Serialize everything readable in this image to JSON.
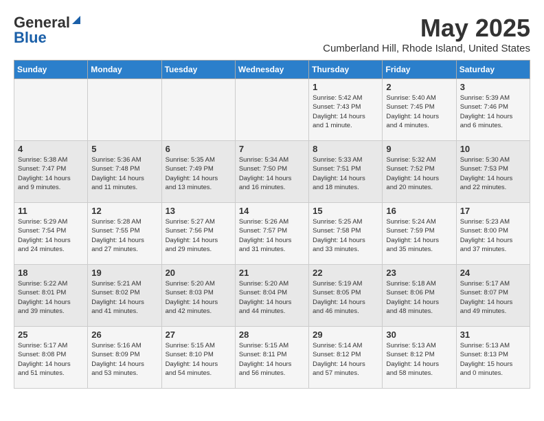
{
  "logo": {
    "line1": "General",
    "line2": "Blue"
  },
  "title": "May 2025",
  "subtitle": "Cumberland Hill, Rhode Island, United States",
  "days_of_week": [
    "Sunday",
    "Monday",
    "Tuesday",
    "Wednesday",
    "Thursday",
    "Friday",
    "Saturday"
  ],
  "weeks": [
    [
      {
        "day": "",
        "info": ""
      },
      {
        "day": "",
        "info": ""
      },
      {
        "day": "",
        "info": ""
      },
      {
        "day": "",
        "info": ""
      },
      {
        "day": "1",
        "info": "Sunrise: 5:42 AM\nSunset: 7:43 PM\nDaylight: 14 hours\nand 1 minute."
      },
      {
        "day": "2",
        "info": "Sunrise: 5:40 AM\nSunset: 7:45 PM\nDaylight: 14 hours\nand 4 minutes."
      },
      {
        "day": "3",
        "info": "Sunrise: 5:39 AM\nSunset: 7:46 PM\nDaylight: 14 hours\nand 6 minutes."
      }
    ],
    [
      {
        "day": "4",
        "info": "Sunrise: 5:38 AM\nSunset: 7:47 PM\nDaylight: 14 hours\nand 9 minutes."
      },
      {
        "day": "5",
        "info": "Sunrise: 5:36 AM\nSunset: 7:48 PM\nDaylight: 14 hours\nand 11 minutes."
      },
      {
        "day": "6",
        "info": "Sunrise: 5:35 AM\nSunset: 7:49 PM\nDaylight: 14 hours\nand 13 minutes."
      },
      {
        "day": "7",
        "info": "Sunrise: 5:34 AM\nSunset: 7:50 PM\nDaylight: 14 hours\nand 16 minutes."
      },
      {
        "day": "8",
        "info": "Sunrise: 5:33 AM\nSunset: 7:51 PM\nDaylight: 14 hours\nand 18 minutes."
      },
      {
        "day": "9",
        "info": "Sunrise: 5:32 AM\nSunset: 7:52 PM\nDaylight: 14 hours\nand 20 minutes."
      },
      {
        "day": "10",
        "info": "Sunrise: 5:30 AM\nSunset: 7:53 PM\nDaylight: 14 hours\nand 22 minutes."
      }
    ],
    [
      {
        "day": "11",
        "info": "Sunrise: 5:29 AM\nSunset: 7:54 PM\nDaylight: 14 hours\nand 24 minutes."
      },
      {
        "day": "12",
        "info": "Sunrise: 5:28 AM\nSunset: 7:55 PM\nDaylight: 14 hours\nand 27 minutes."
      },
      {
        "day": "13",
        "info": "Sunrise: 5:27 AM\nSunset: 7:56 PM\nDaylight: 14 hours\nand 29 minutes."
      },
      {
        "day": "14",
        "info": "Sunrise: 5:26 AM\nSunset: 7:57 PM\nDaylight: 14 hours\nand 31 minutes."
      },
      {
        "day": "15",
        "info": "Sunrise: 5:25 AM\nSunset: 7:58 PM\nDaylight: 14 hours\nand 33 minutes."
      },
      {
        "day": "16",
        "info": "Sunrise: 5:24 AM\nSunset: 7:59 PM\nDaylight: 14 hours\nand 35 minutes."
      },
      {
        "day": "17",
        "info": "Sunrise: 5:23 AM\nSunset: 8:00 PM\nDaylight: 14 hours\nand 37 minutes."
      }
    ],
    [
      {
        "day": "18",
        "info": "Sunrise: 5:22 AM\nSunset: 8:01 PM\nDaylight: 14 hours\nand 39 minutes."
      },
      {
        "day": "19",
        "info": "Sunrise: 5:21 AM\nSunset: 8:02 PM\nDaylight: 14 hours\nand 41 minutes."
      },
      {
        "day": "20",
        "info": "Sunrise: 5:20 AM\nSunset: 8:03 PM\nDaylight: 14 hours\nand 42 minutes."
      },
      {
        "day": "21",
        "info": "Sunrise: 5:20 AM\nSunset: 8:04 PM\nDaylight: 14 hours\nand 44 minutes."
      },
      {
        "day": "22",
        "info": "Sunrise: 5:19 AM\nSunset: 8:05 PM\nDaylight: 14 hours\nand 46 minutes."
      },
      {
        "day": "23",
        "info": "Sunrise: 5:18 AM\nSunset: 8:06 PM\nDaylight: 14 hours\nand 48 minutes."
      },
      {
        "day": "24",
        "info": "Sunrise: 5:17 AM\nSunset: 8:07 PM\nDaylight: 14 hours\nand 49 minutes."
      }
    ],
    [
      {
        "day": "25",
        "info": "Sunrise: 5:17 AM\nSunset: 8:08 PM\nDaylight: 14 hours\nand 51 minutes."
      },
      {
        "day": "26",
        "info": "Sunrise: 5:16 AM\nSunset: 8:09 PM\nDaylight: 14 hours\nand 53 minutes."
      },
      {
        "day": "27",
        "info": "Sunrise: 5:15 AM\nSunset: 8:10 PM\nDaylight: 14 hours\nand 54 minutes."
      },
      {
        "day": "28",
        "info": "Sunrise: 5:15 AM\nSunset: 8:11 PM\nDaylight: 14 hours\nand 56 minutes."
      },
      {
        "day": "29",
        "info": "Sunrise: 5:14 AM\nSunset: 8:12 PM\nDaylight: 14 hours\nand 57 minutes."
      },
      {
        "day": "30",
        "info": "Sunrise: 5:13 AM\nSunset: 8:12 PM\nDaylight: 14 hours\nand 58 minutes."
      },
      {
        "day": "31",
        "info": "Sunrise: 5:13 AM\nSunset: 8:13 PM\nDaylight: 15 hours\nand 0 minutes."
      }
    ]
  ]
}
